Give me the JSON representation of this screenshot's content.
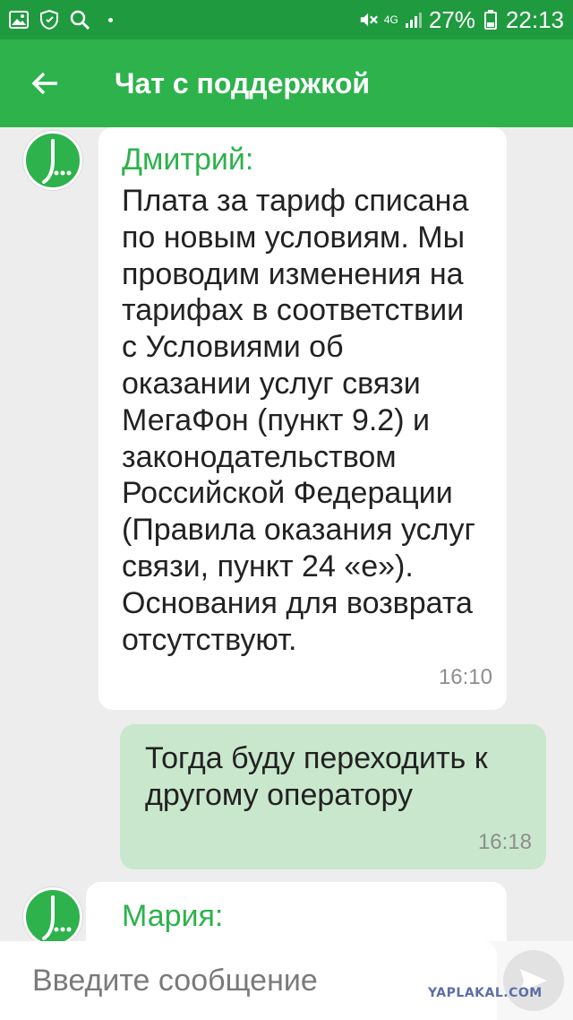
{
  "status_bar": {
    "icons": [
      "image-icon",
      "shield-icon",
      "search-icon",
      "dot-icon",
      "mute-icon",
      "network-4g-icon",
      "signal-icon",
      "battery-icon"
    ],
    "network": "4G",
    "battery": "27%",
    "time": "22:13"
  },
  "app_bar": {
    "back_icon": "arrow-left-icon",
    "title": "Чат с поддержкой"
  },
  "messages": [
    {
      "direction": "incoming",
      "sender": "Дмитрий:",
      "text": "Плата за тариф списана\nпо новым условиям. Мы\nпроводим изменения на\nтарифах в соответствии\nс Условиями об\nоказании услуг связи\nМегаФон (пункт 9.2) и\nзаконодательством\nРоссийской Федерации\n(Правила оказания услуг\nсвязи, пункт 24 «е»).\nОснования для возврата\nотсутствуют.",
      "time": "16:10"
    },
    {
      "direction": "outgoing",
      "text": "Тогда буду переходить к\nдругому оператору",
      "time": "16:18"
    },
    {
      "direction": "incoming",
      "sender": "Мария:",
      "text": "",
      "time": ""
    }
  ],
  "composer": {
    "placeholder": "Введите сообщение",
    "value": "",
    "send_icon": "send-icon"
  },
  "watermark": "YAPLAKAL.COM",
  "colors": {
    "status_bar": "#1f9a3f",
    "app_bar": "#2db24c",
    "accent": "#2db24c",
    "outgoing_bubble": "#c9e7cc",
    "background": "#ededed"
  }
}
